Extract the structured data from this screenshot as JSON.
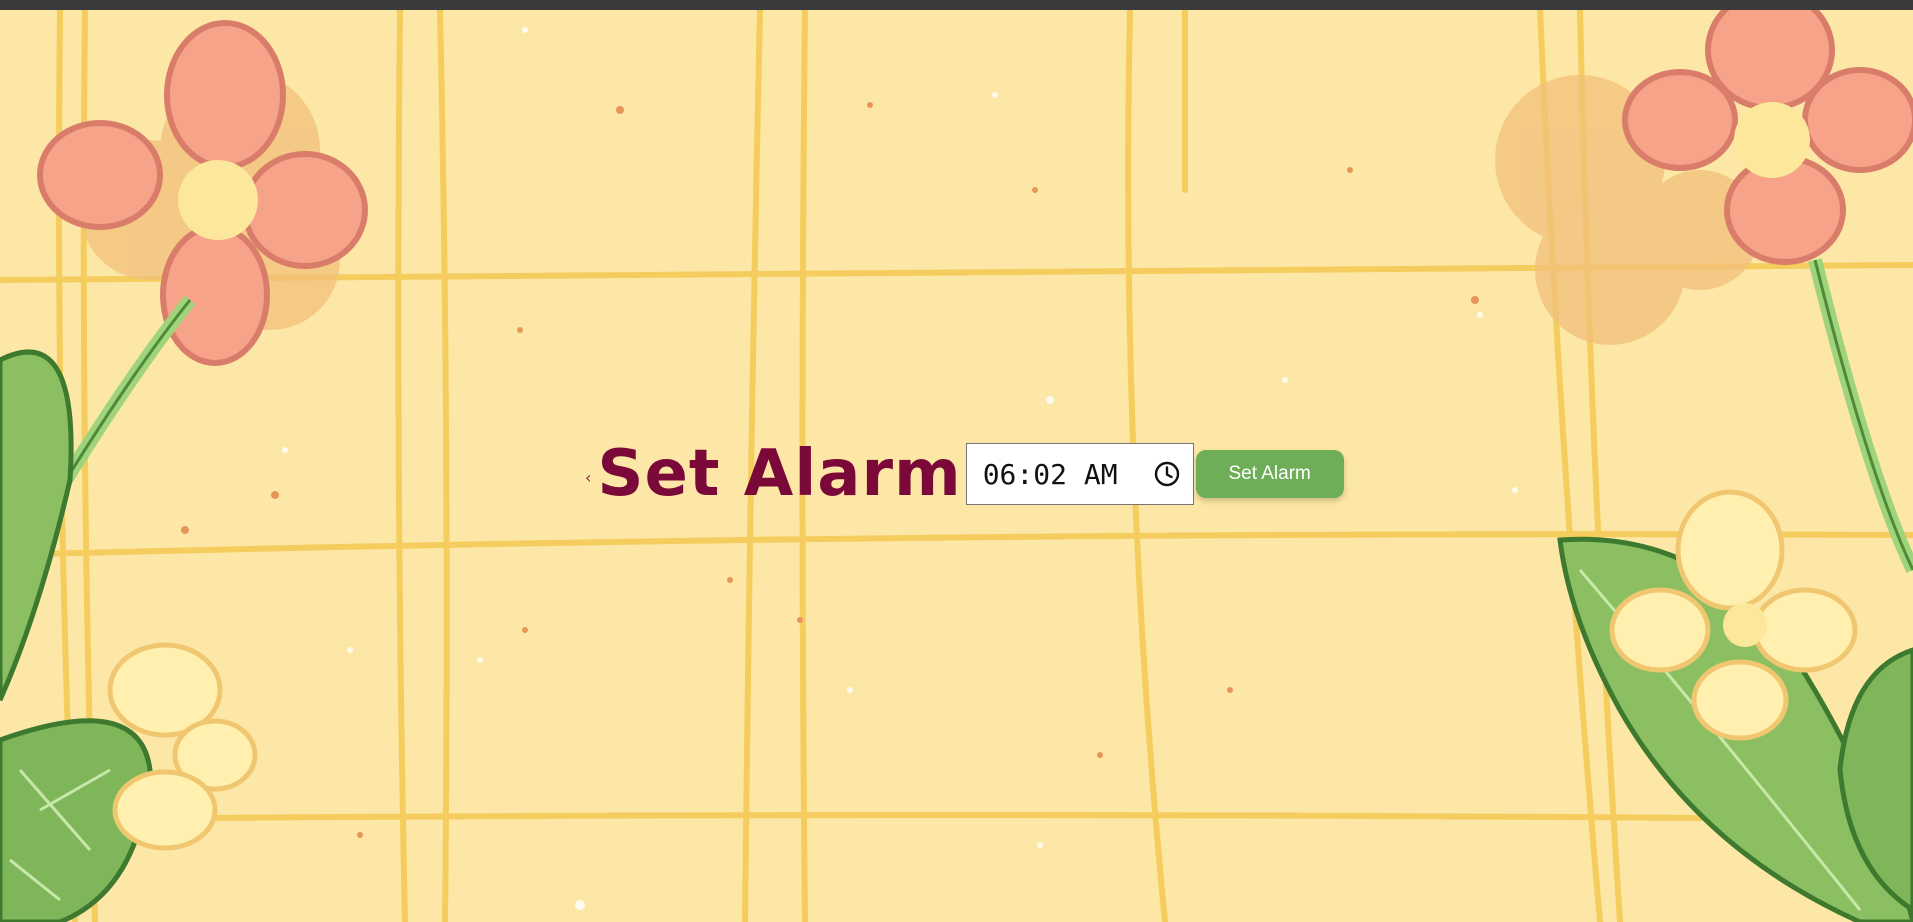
{
  "page": {
    "title": "Set Alarm",
    "back_glyph": "‹"
  },
  "alarm": {
    "time_value": "06:02 AM",
    "clock_icon": "clock-icon",
    "button_label": "Set Alarm"
  },
  "colors": {
    "background": "#fde7a6",
    "title": "#7a0838",
    "button": "#6fae58",
    "grid_lines": "#f5cd5e"
  }
}
